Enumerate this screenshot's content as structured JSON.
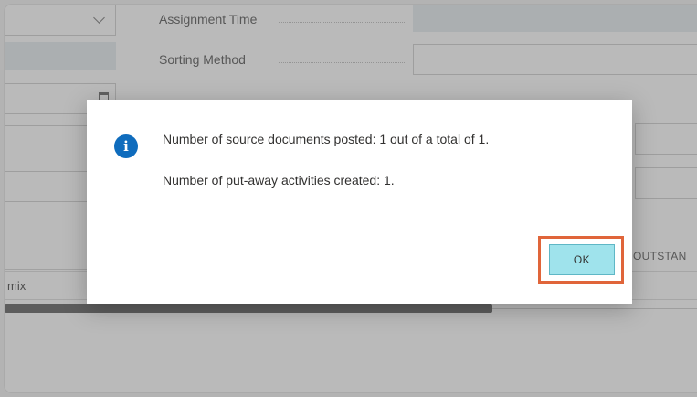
{
  "form": {
    "assignment_time_label": "Assignment Time",
    "sorting_method_label": "Sorting Method",
    "calendar_icon": "calendar-icon",
    "dropdown_icon": "chevron-down-icon"
  },
  "grid": {
    "header_text": "OUTSTAN",
    "row_text": "mix"
  },
  "dialog": {
    "icon": "info-icon",
    "icon_glyph": "i",
    "message_line_1": "Number of source documents posted: 1 out of a total of 1.",
    "message_line_2": "Number of put-away activities created: 1.",
    "ok_label": "OK"
  },
  "colors": {
    "accent": "#0f6cbd",
    "ok_button_bg": "#9fe3ec",
    "highlight_border": "#e0653a"
  }
}
